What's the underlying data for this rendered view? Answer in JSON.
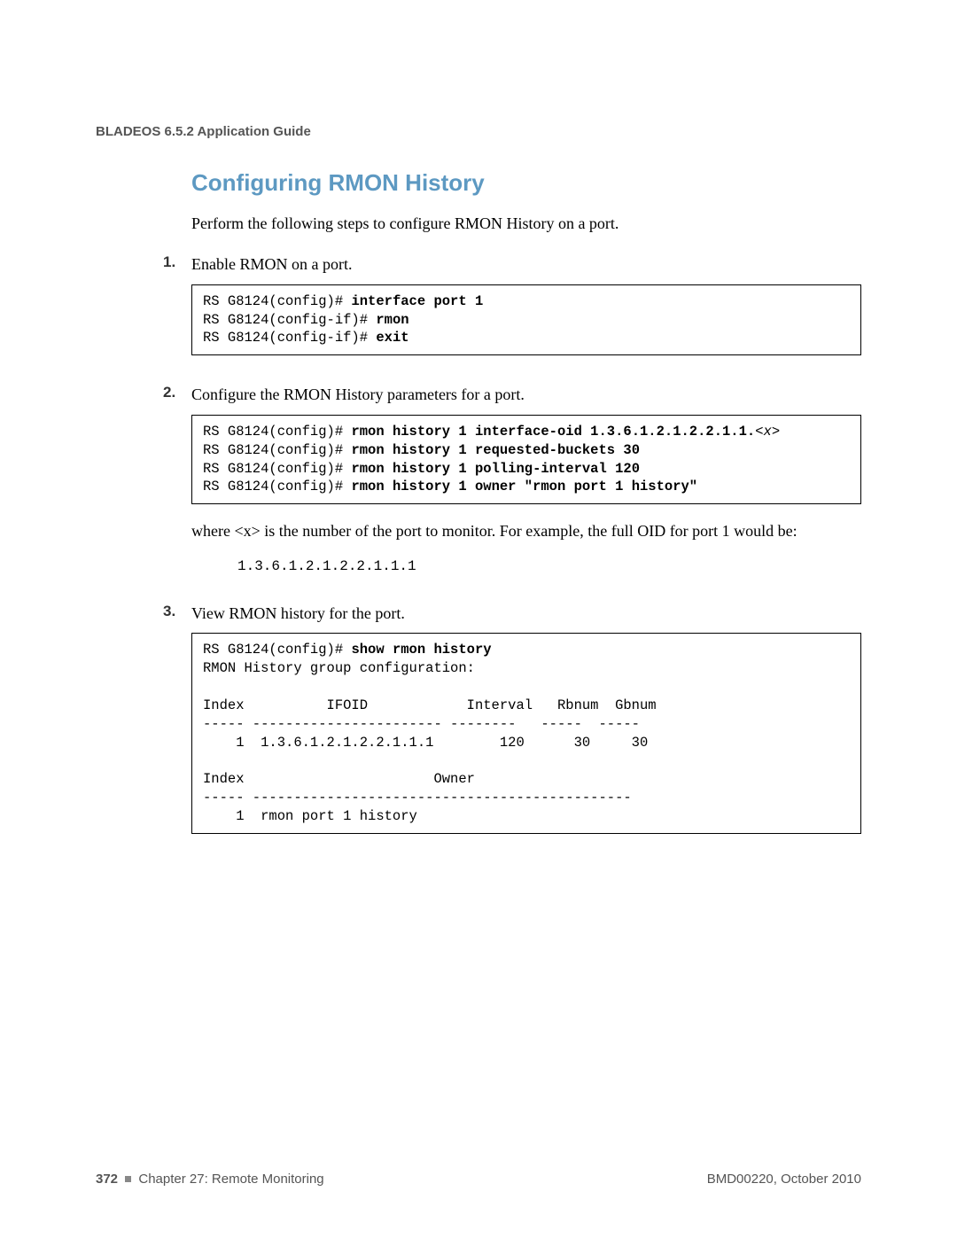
{
  "header": {
    "guide": "BLADEOS 6.5.2 Application Guide"
  },
  "section": {
    "title": "Configuring RMON History"
  },
  "intro": "Perform the following steps to configure RMON History on a port.",
  "steps": {
    "n1": "1.",
    "t1": "Enable RMON on a port.",
    "code1": {
      "l1a": "RS G8124(config)# ",
      "l1b": "interface port 1",
      "l2a": "RS G8124(config-if)# ",
      "l2b": "rmon",
      "l3a": "RS G8124(config-if)# ",
      "l3b": "exit"
    },
    "n2": "2.",
    "t2": "Configure the RMON History parameters for a port.",
    "code2": {
      "l1a": "RS G8124(config)# ",
      "l1b": "rmon history 1 interface-oid 1.3.6.1.2.1.2.2.1.1.",
      "l1c": "<x>",
      "l2a": "RS G8124(config)# ",
      "l2b": "rmon history 1 requested-buckets 30",
      "l3a": "RS G8124(config)# ",
      "l3b": "rmon history 1 polling-interval 120",
      "l4a": "RS G8124(config)# ",
      "l4b": "rmon history 1 owner \"rmon port 1 history\""
    },
    "where": "where <x> is the number of the port to monitor. For example, the full OID for port 1 would be:",
    "oid": "1.3.6.1.2.1.2.2.1.1.1",
    "n3": "3.",
    "t3": "View RMON history for the port.",
    "code3": {
      "l1a": "RS G8124(config)# ",
      "l1b": "show rmon history",
      "l2": "RMON History group configuration:",
      "l3": "",
      "l4": "Index          IFOID            Interval   Rbnum  Gbnum",
      "l5": "----- ----------------------- --------   -----  -----",
      "l6": "    1  1.3.6.1.2.1.2.2.1.1.1        120      30     30",
      "l7": "",
      "l8": "Index                       Owner",
      "l9": "----- ----------------------------------------------",
      "l10": "    1  rmon port 1 history"
    }
  },
  "footer": {
    "page": "372",
    "chapter": "Chapter 27: Remote Monitoring",
    "docref": "BMD00220, October 2010"
  }
}
